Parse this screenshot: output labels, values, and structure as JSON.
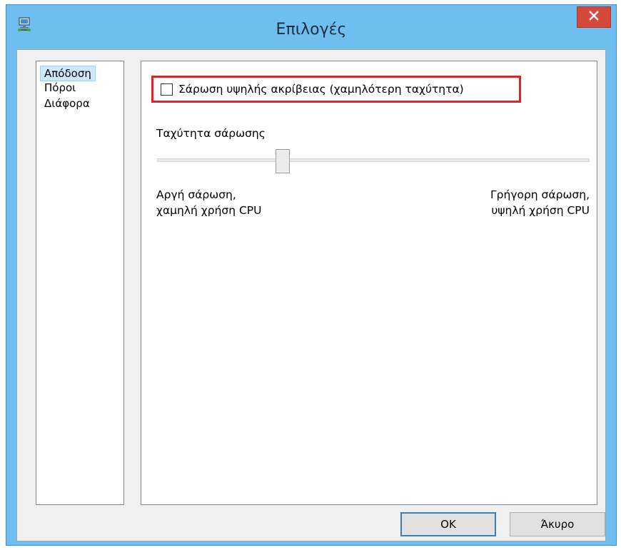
{
  "window": {
    "title": "Επιλογές",
    "icon": "network-computer-icon",
    "close_icon": "close-icon"
  },
  "categories": {
    "items": [
      {
        "label": "Απόδοση",
        "selected": true
      },
      {
        "label": "Πόροι",
        "selected": false
      },
      {
        "label": "Διάφορα",
        "selected": false
      }
    ]
  },
  "performance": {
    "high_accuracy_checkbox": {
      "label": "Σάρωση υψηλής ακρίβειας (χαμηλότερη ταχύτητα)",
      "checked": false
    },
    "speed_label": "Ταχύτητα σάρωσης",
    "speed_slider": {
      "position_fraction": 0.29
    },
    "slow_label_line1": "Αργή σάρωση,",
    "slow_label_line2": "χαμηλή χρήση CPU",
    "fast_label_line1": "Γρήγορη σάρωση,",
    "fast_label_line2": "υψηλή χρήση CPU"
  },
  "buttons": {
    "ok_label": "OK",
    "cancel_label": "Άκυρο"
  },
  "colors": {
    "titlebar": "#6ebff0",
    "close_button": "#d5493b",
    "highlight_border": "#e0232b",
    "selected_item": "#cde8ff"
  }
}
